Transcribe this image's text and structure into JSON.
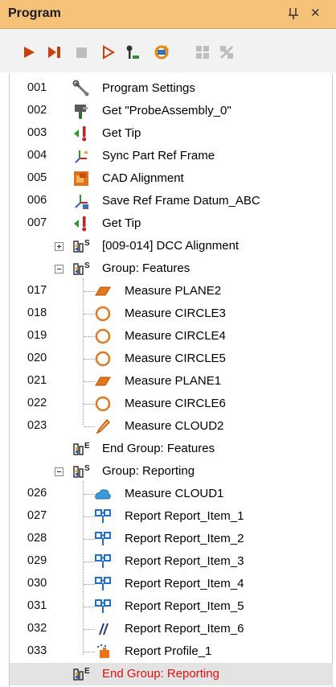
{
  "panel": {
    "title": "Program",
    "pin_glyph": "ᚘ",
    "close_glyph": "✕"
  },
  "toolbar": {
    "icons": [
      "play-icon",
      "step-next-icon",
      "stop-icon",
      "step-into-icon",
      "key-icon",
      "refresh-icon",
      "grid-icon",
      "cancel-icon"
    ]
  },
  "tree": {
    "rows": [
      {
        "num": "001",
        "label": "Program Settings",
        "icon": "wrench-icon"
      },
      {
        "num": "002",
        "label": "Get \"ProbeAssembly_0\"",
        "icon": "probe-assembly-icon"
      },
      {
        "num": "003",
        "label": "Get Tip",
        "icon": "get-tip-icon"
      },
      {
        "num": "004",
        "label": "Sync Part Ref Frame",
        "icon": "sync-frame-icon"
      },
      {
        "num": "005",
        "label": "CAD Alignment",
        "icon": "cad-alignment-icon"
      },
      {
        "num": "006",
        "label": "Save Ref Frame Datum_ABC",
        "icon": "save-frame-icon"
      },
      {
        "num": "007",
        "label": "Get Tip",
        "icon": "get-tip-icon"
      },
      {
        "num": "",
        "label": "[009-014] DCC Alignment",
        "icon": "group-start-icon",
        "expander": "+"
      },
      {
        "num": "",
        "label": "Group: Features",
        "icon": "group-start-icon",
        "expander": "-"
      },
      {
        "num": "017",
        "label": "Measure PLANE2",
        "icon": "plane-icon"
      },
      {
        "num": "018",
        "label": "Measure CIRCLE3",
        "icon": "circle-icon"
      },
      {
        "num": "019",
        "label": "Measure CIRCLE4",
        "icon": "circle-icon"
      },
      {
        "num": "020",
        "label": "Measure CIRCLE5",
        "icon": "circle-icon"
      },
      {
        "num": "021",
        "label": "Measure PLANE1",
        "icon": "plane-icon"
      },
      {
        "num": "022",
        "label": "Measure CIRCLE6",
        "icon": "circle-icon"
      },
      {
        "num": "023",
        "label": "Measure CLOUD2",
        "icon": "cloud-probe-icon"
      },
      {
        "num": "",
        "label": "End Group: Features",
        "icon": "group-end-icon"
      },
      {
        "num": "",
        "label": "Group: Reporting",
        "icon": "group-start-icon",
        "expander": "-"
      },
      {
        "num": "026",
        "label": "Measure CLOUD1",
        "icon": "cloud-icon"
      },
      {
        "num": "027",
        "label": "Report Report_Item_1",
        "icon": "report-icon"
      },
      {
        "num": "028",
        "label": "Report Report_Item_2",
        "icon": "report-icon"
      },
      {
        "num": "029",
        "label": "Report Report_Item_3",
        "icon": "report-icon"
      },
      {
        "num": "030",
        "label": "Report Report_Item_4",
        "icon": "report-icon"
      },
      {
        "num": "031",
        "label": "Report Report_Item_5",
        "icon": "report-icon"
      },
      {
        "num": "032",
        "label": "Report Report_Item_6",
        "icon": "parallel-icon"
      },
      {
        "num": "033",
        "label": "Report Profile_1",
        "icon": "profile-report-icon"
      },
      {
        "num": "",
        "label": "End Group: Reporting",
        "icon": "group-end-icon",
        "selected": true,
        "color": "#e01010"
      }
    ]
  },
  "colors": {
    "title_bar": "#f6c27a",
    "selected_row": "#e3e3e3",
    "selected_text": "#e01010"
  }
}
